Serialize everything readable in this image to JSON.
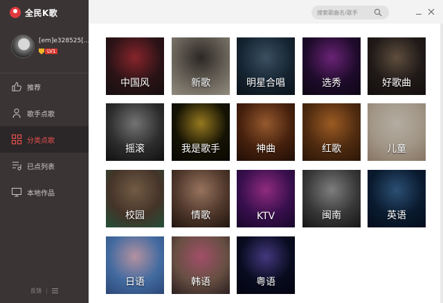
{
  "app": {
    "name": "全民K歌",
    "accent": "#e0393e"
  },
  "user": {
    "name": "[em]e328525[...",
    "level": "LV1"
  },
  "nav": [
    {
      "label": "推荐",
      "icon": "thumbs-up-icon",
      "active": false
    },
    {
      "label": "歌手点歌",
      "icon": "singer-icon",
      "active": false
    },
    {
      "label": "分类点歌",
      "icon": "category-grid-icon",
      "active": true
    },
    {
      "label": "已点列表",
      "icon": "playlist-icon",
      "active": false
    },
    {
      "label": "本地作品",
      "icon": "monitor-icon",
      "active": false
    }
  ],
  "footer": {
    "feedback": "反馈",
    "separator": "|"
  },
  "search": {
    "placeholder": "搜索歌曲名/歌手"
  },
  "categories": [
    {
      "label": "中国风",
      "colors": [
        "#3a1a1e",
        "#b4313a",
        "#1c1416"
      ]
    },
    {
      "label": "新歌",
      "colors": [
        "#8a8276",
        "#3b3630",
        "#c4bba9"
      ]
    },
    {
      "label": "明星合唱",
      "colors": [
        "#1d3142",
        "#4d6a82",
        "#0e1822"
      ]
    },
    {
      "label": "选秀",
      "colors": [
        "#2a0f3a",
        "#8d2f9e",
        "#12081c"
      ]
    },
    {
      "label": "好歌曲",
      "colors": [
        "#2a2220",
        "#7e6752",
        "#1a1413"
      ]
    },
    {
      "label": "摇滚",
      "colors": [
        "#3d3d3d",
        "#9a9a9a",
        "#161616"
      ]
    },
    {
      "label": "我是歌手",
      "colors": [
        "#1d1a06",
        "#c8a12a",
        "#0c0b03"
      ]
    },
    {
      "label": "神曲",
      "colors": [
        "#5e2c12",
        "#c7773e",
        "#2b1308"
      ]
    },
    {
      "label": "红歌",
      "colors": [
        "#6a3a16",
        "#d07a30",
        "#3a1e0a"
      ]
    },
    {
      "label": "儿童",
      "colors": [
        "#d7c8b4",
        "#f1e6d8",
        "#b49b82"
      ]
    },
    {
      "label": "校园",
      "colors": [
        "#5b4536",
        "#9a7a5c",
        "#2e6a4a"
      ]
    },
    {
      "label": "情歌",
      "colors": [
        "#6a4a3a",
        "#c99a7e",
        "#2c1c14"
      ]
    },
    {
      "label": "KTV",
      "colors": [
        "#4a1466",
        "#c03aa8",
        "#200a38"
      ]
    },
    {
      "label": "闽南",
      "colors": [
        "#4b4b4b",
        "#a8a8a8",
        "#1e1e1e"
      ]
    },
    {
      "label": "英语",
      "colors": [
        "#0e2440",
        "#3a6a9a",
        "#061226"
      ]
    },
    {
      "label": "日语",
      "colors": [
        "#5a8fd6",
        "#f0c2d6",
        "#3a5f9e"
      ]
    },
    {
      "label": "韩语",
      "colors": [
        "#8a6a5a",
        "#d86a8a",
        "#3a2a2a"
      ]
    },
    {
      "label": "粤语",
      "colors": [
        "#0c0f2a",
        "#5a4aa8",
        "#050616"
      ]
    }
  ]
}
